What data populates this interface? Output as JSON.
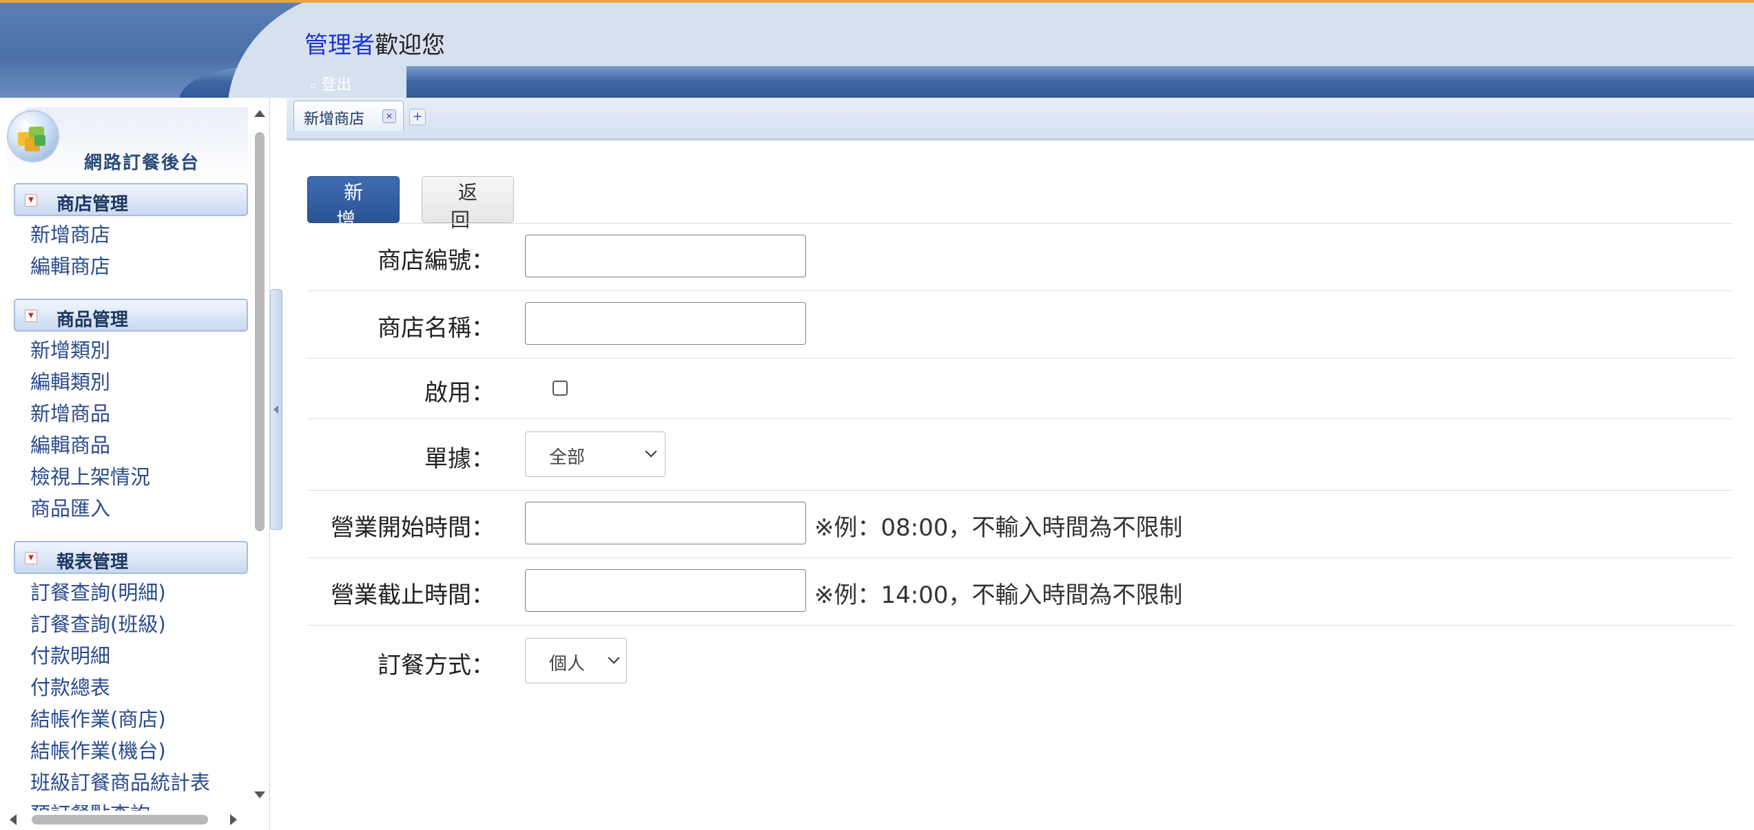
{
  "header": {
    "welcome_role": "管理者",
    "welcome_text": "歡迎您",
    "logout_label": "登出"
  },
  "sidebar": {
    "title": "網路訂餐後台",
    "groups": [
      {
        "label": "商店管理",
        "items": [
          "新增商店",
          "編輯商店"
        ]
      },
      {
        "label": "商品管理",
        "items": [
          "新增類別",
          "編輯類別",
          "新增商品",
          "編輯商品",
          "檢視上架情況",
          "商品匯入"
        ]
      },
      {
        "label": "報表管理",
        "items": [
          "訂餐查詢(明細)",
          "訂餐查詢(班級)",
          "付款明細",
          "付款總表",
          "結帳作業(商店)",
          "結帳作業(機台)",
          "班級訂餐商品統計表",
          "預訂餐點查詢"
        ]
      }
    ]
  },
  "tabs": {
    "active_label": "新增商店",
    "add_symbol": "+"
  },
  "toolbar": {
    "add_label": "新增",
    "back_label": "返回"
  },
  "form": {
    "store_id_label": "商店編號：",
    "store_id_value": "",
    "store_name_label": "商店名稱：",
    "store_name_value": "",
    "enabled_label": "啟用：",
    "enabled_checked": false,
    "document_label": "單據：",
    "document_value": "全部",
    "open_time_label": "營業開始時間：",
    "open_time_value": "",
    "open_time_hint": "※例：08:00，不輸入時間為不限制",
    "close_time_label": "營業截止時間：",
    "close_time_value": "",
    "close_time_hint": "※例：14:00，不輸入時間為不限制",
    "order_mode_label": "訂餐方式：",
    "order_mode_value": "個人"
  },
  "colors": {
    "accent": "#2a5393",
    "header_bg": "#d6e1ef",
    "top_border": "#e7a53b",
    "link": "#2a4a8f",
    "role_text": "#1d34c9"
  },
  "icons": {
    "group_toggle": "collapse-icon",
    "tab_close": "close-icon",
    "logo": "cubes-icon"
  }
}
